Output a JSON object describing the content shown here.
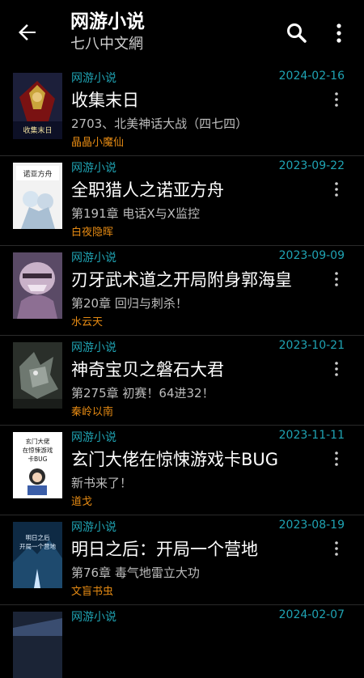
{
  "header": {
    "title": "网游小说",
    "subtitle": "七八中文網",
    "back_icon": "arrow-back-icon",
    "search_icon": "search-icon",
    "more_icon": "more-vert-icon"
  },
  "colors": {
    "background": "#000000",
    "category": "#1fa3b3",
    "date": "#1fa3b3",
    "author": "#e58a13",
    "title": "#ffffff",
    "chapter": "#bdbdbd"
  },
  "books": [
    {
      "category": "网游小说",
      "date": "2024-02-16",
      "title": "收集末日",
      "chapter": "2703、北美神话大战（四七四）",
      "author": "晶晶小魔仙",
      "cover_text": "收集末日"
    },
    {
      "category": "网游小说",
      "date": "2023-09-22",
      "title": "全职猎人之诺亚方舟",
      "chapter": "第191章 电话X与X监控",
      "author": "白夜隐晖",
      "cover_text": "诺亚方舟"
    },
    {
      "category": "网游小说",
      "date": "2023-09-09",
      "title": "刃牙武术道之开局附身郭海皇",
      "chapter": "第20章 回归与刺杀！",
      "author": "水云天",
      "cover_text": ""
    },
    {
      "category": "网游小说",
      "date": "2023-10-21",
      "title": "神奇宝贝之磐石大君",
      "chapter": "第275章 初赛！64进32！",
      "author": "秦岭以南",
      "cover_text": ""
    },
    {
      "category": "网游小说",
      "date": "2023-11-11",
      "title": "玄门大佬在惊悚游戏卡BUG",
      "chapter": "新书来了！",
      "author": "道戈",
      "cover_text": "玄门大佬在惊悚游戏卡BUG"
    },
    {
      "category": "网游小说",
      "date": "2023-08-19",
      "title": "明日之后：开局一个营地",
      "chapter": "第76章 毒气地雷立大功",
      "author": "文盲书虫",
      "cover_text": "明日之后开局一个营地"
    },
    {
      "category": "网游小说",
      "date": "2024-02-07",
      "title": "",
      "chapter": "",
      "author": "",
      "cover_text": ""
    }
  ]
}
